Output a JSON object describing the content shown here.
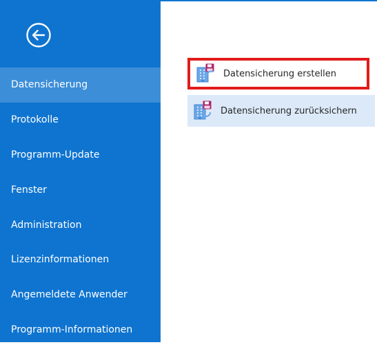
{
  "sidebar": {
    "items": [
      {
        "label": "Datensicherung",
        "selected": true
      },
      {
        "label": "Protokolle",
        "selected": false
      },
      {
        "label": "Programm-Update",
        "selected": false
      },
      {
        "label": "Fenster",
        "selected": false
      },
      {
        "label": "Administration",
        "selected": false
      },
      {
        "label": "Lizenzinformationen",
        "selected": false
      },
      {
        "label": "Angemeldete Anwender",
        "selected": false
      },
      {
        "label": "Programm-Informationen",
        "selected": false
      }
    ]
  },
  "main": {
    "actions": [
      {
        "label": "Datensicherung erstellen",
        "icon": "building-floppy-icon",
        "highlighted": true
      },
      {
        "label": "Datensicherung zurücksichern",
        "icon": "building-floppy-restore-icon",
        "highlighted": false
      }
    ]
  },
  "colors": {
    "sidebar_bg": "#0f74d0",
    "selected_bg": "#3c8ed8",
    "hover_bg": "#dce9f8",
    "highlight_border": "#e21b1b",
    "icon_accent": "#b1256a"
  }
}
